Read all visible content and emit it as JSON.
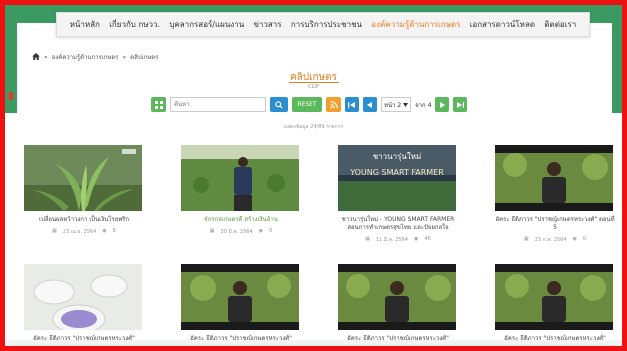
{
  "nav": {
    "items": [
      {
        "label": "หน้าหลัก",
        "active": false
      },
      {
        "label": "เกี่ยวกับ กษวว.",
        "active": false
      },
      {
        "label": "บุคลากรสอร์/แผนงาน",
        "active": false
      },
      {
        "label": "ข่าวสาร",
        "active": false
      },
      {
        "label": "การบริการประชาชน",
        "active": false
      },
      {
        "label": "องค์ความรู้ด้านการเกษตร",
        "active": true
      },
      {
        "label": "เอกสารดาวน์โหลด",
        "active": false
      },
      {
        "label": "ติดต่อเรา",
        "active": false
      }
    ]
  },
  "breadcrumb": {
    "home_icon": "home-icon",
    "sep1": "»",
    "item1": "องค์ความรู้ด้านการเกษตร",
    "sep2": "»",
    "item2": "คลิปเกษตร"
  },
  "page": {
    "title": "คลิปเกษตร",
    "subtitle": "CLIP"
  },
  "toolbar": {
    "search_placeholder": "ค้นหา",
    "reset_label": "RESET",
    "page_label": "หน้า 2",
    "page_total": "จาก 4"
  },
  "listing": {
    "count_text": "แสดงข้อมูล 24/89 รายการ"
  },
  "cards": [
    {
      "title": "เปลี่ยนผลหว้าวงกา เป็นเงินโรยพริก",
      "date": "23 เม.ย. 2564",
      "views": "8",
      "title_color": "dark"
    },
    {
      "title": "จักรกลเกษตรดี สร้างเงินล้าน",
      "date": "30 มี.ค. 2564",
      "views": "0",
      "title_color": "green"
    },
    {
      "title": "ชาวนารุ่นใหม่ - YOUNG SMART FARMER สอนการทำเกษตรสุขไทย และปัจยกลใจ",
      "date": "11 มี.ค. 2564",
      "views": "46",
      "title_color": "dark",
      "overlay_text": "YOUNG SMART FARMER",
      "overlay_sub": "ชาวนารุ่นใหม่"
    },
    {
      "title": "อัคระ ธีติภาวร \"ปราชญ์เกษตรหระวงศ์\" ตอนที่ 5",
      "date": "23 ก.พ. 2564",
      "views": "0",
      "title_color": "dark"
    },
    {
      "title": "อัคระ ธีติภาวร \"ปราชญ์เกษตรหระวงศ์\"",
      "date": "",
      "views": "",
      "title_color": "dark"
    },
    {
      "title": "อัคระ ธีติภาวร \"ปราชญ์เกษตรหระวงศ์\"",
      "date": "",
      "views": "",
      "title_color": "dark"
    },
    {
      "title": "อัคระ ธีติภาวร \"ปราชญ์เกษตรหระวงศ์\"",
      "date": "",
      "views": "",
      "title_color": "dark"
    },
    {
      "title": "อัคระ ธีติภาวร \"ปราชญ์เกษตรหระวงศ์\"",
      "date": "",
      "views": "",
      "title_color": "dark"
    }
  ],
  "icons": {
    "calendar": "calendar-icon",
    "views": "eye-icon",
    "search": "search-icon",
    "rss": "rss-icon",
    "grid": "grid-icon"
  },
  "colors": {
    "brand_green": "#3a9a62",
    "accent_orange": "#e67e22",
    "button_blue": "#2a8fd0",
    "button_green": "#5cb85c",
    "frame_red": "#e11111"
  }
}
